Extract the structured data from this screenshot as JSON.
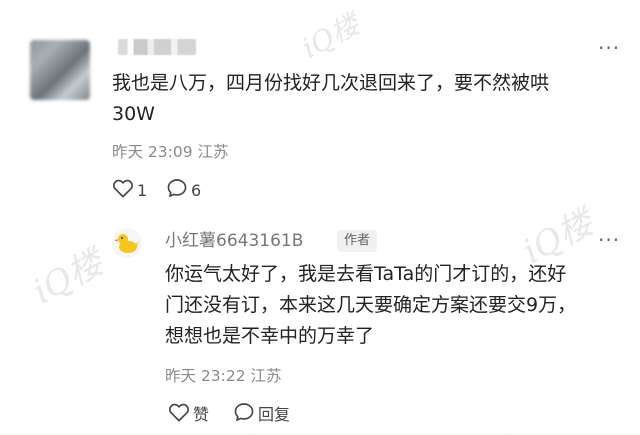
{
  "comment": {
    "text_line1": "我也是八万，四月份找好几次退回来了，要不然被哄",
    "text_line2": "30W",
    "time": "昨天 23:09",
    "location": "江苏",
    "likes": "1",
    "replies": "6",
    "more": "···"
  },
  "reply": {
    "username": "小红薯6643161B",
    "badge": "作者",
    "line1": "你运气太好了，我是去看TaTa的门才订的，还好",
    "line2": "门还没有订，本来这几天要确定方案还要交9万，",
    "line3": "想想也是不幸中的万幸了",
    "time": "昨天 23:22",
    "location": "江苏",
    "like_label": "赞",
    "reply_label": "回复",
    "more": "···"
  }
}
